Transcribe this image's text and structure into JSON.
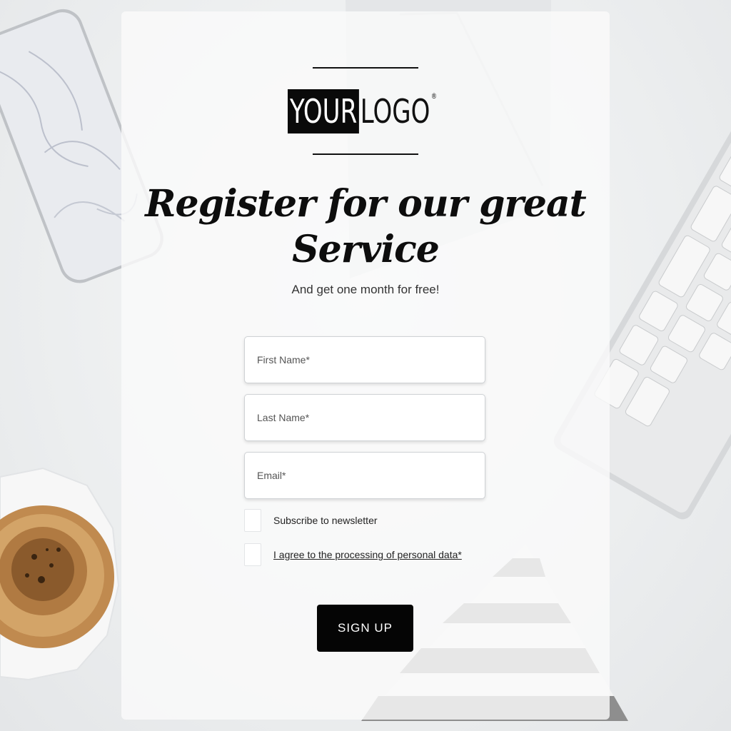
{
  "logo": {
    "part1": "YOUR",
    "part2": "LOGO",
    "mark": "®"
  },
  "heading": {
    "title": "Register for our great Service",
    "subtitle": "And get one month for free!"
  },
  "form": {
    "first_name_placeholder": "First Name*",
    "last_name_placeholder": "Last Name*",
    "email_placeholder": "Email*",
    "newsletter_label": "Subscribe to newsletter",
    "consent_label": "I agree to the processing of personal data*",
    "submit_label": "SIGN UP"
  },
  "background": {
    "items": [
      "phone",
      "envelope",
      "keyboard",
      "coffee-cup",
      "striped-pyramid"
    ]
  },
  "colors": {
    "button": "#050505",
    "text": "#0d0d0d",
    "card": "#fafafa"
  }
}
